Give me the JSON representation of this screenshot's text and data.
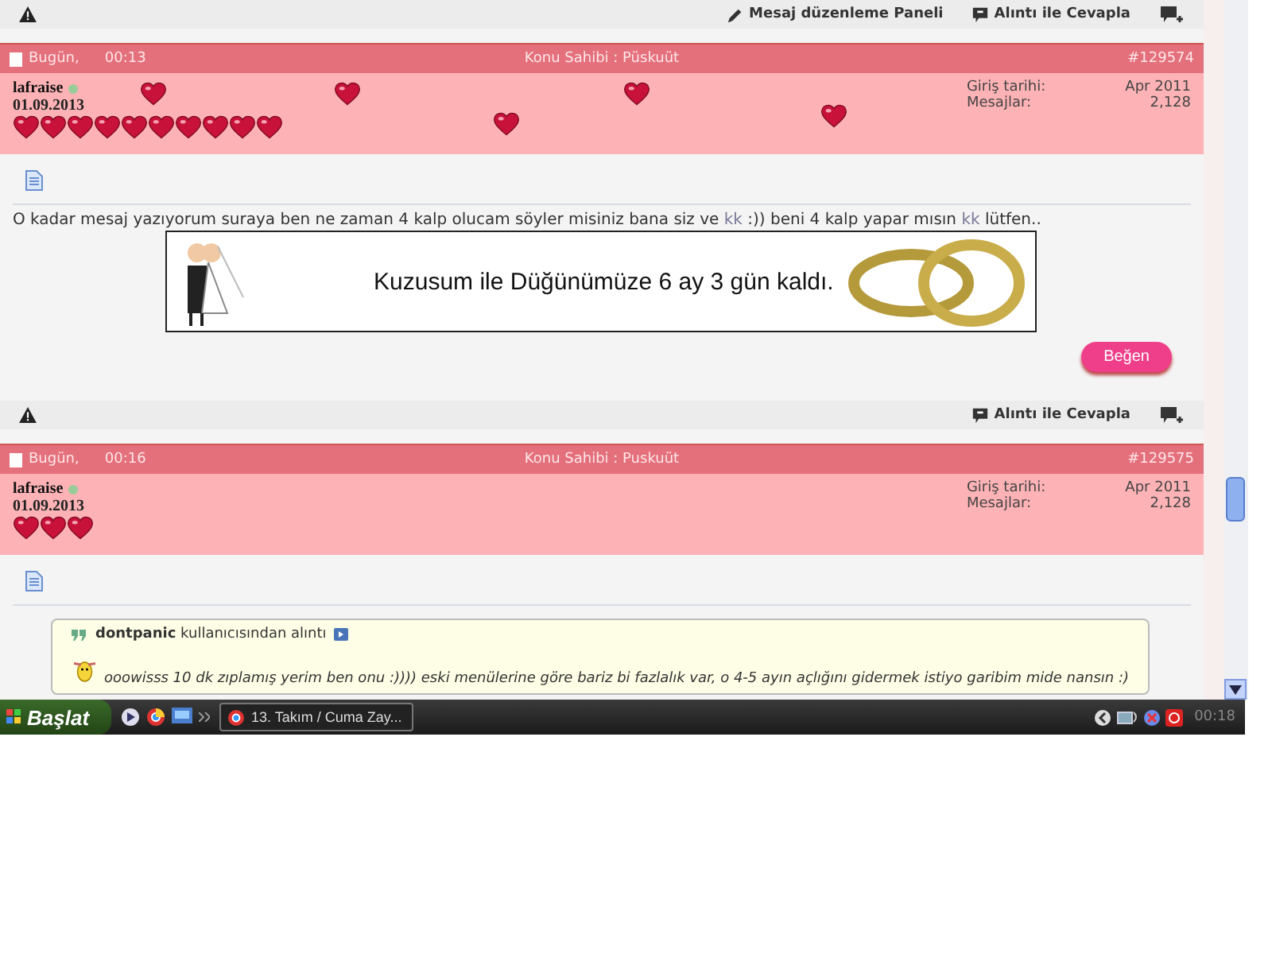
{
  "posts": [
    {
      "toolbar": {
        "actions": [
          {
            "kind": "edit",
            "label": "Mesaj düzenleme Paneli"
          },
          {
            "kind": "quote",
            "label": "Alıntı ile Cevapla"
          },
          {
            "kind": "multiquote"
          }
        ]
      },
      "header": {
        "day": "Bugün,",
        "time": "00:13",
        "owner": "Konu Sahibi : Püskuüt",
        "number": "#129574"
      },
      "user": {
        "name": "lafraise",
        "online": true,
        "date": "01.09.2013",
        "stars": 10,
        "join_label": "Giriş tarihi:",
        "join_value": "Apr 2011",
        "posts_label": "Mesajlar:",
        "posts_value": "2,128"
      },
      "message": [
        {
          "kind": "text",
          "text": "O kadar mesaj yazıyorum suraya ben ne zaman 4 kalp olucam söyler misiniz bana siz ve "
        },
        {
          "kind": "link",
          "text": "kk"
        },
        {
          "kind": "text",
          "text": " :)) beni 4 kalp yapar mısın "
        },
        {
          "kind": "link",
          "text": "kk"
        },
        {
          "kind": "text",
          "text": " lütfen.."
        }
      ],
      "banner": {
        "text": "Kuzusum ile Düğünümüze 6 ay 3 gün kaldı."
      },
      "like_button": "Beğen"
    },
    {
      "toolbar": {
        "actions": [
          {
            "kind": "quote",
            "label": "Alıntı ile Cevapla"
          },
          {
            "kind": "multiquote"
          }
        ]
      },
      "header": {
        "day": "Bugün,",
        "time": "00:16",
        "owner": "Konu Sahibi : Puskuüt",
        "number": "#129575"
      },
      "user": {
        "name": "lafraise",
        "online": true,
        "date": "01.09.2013",
        "stars": 3,
        "join_label": "Giriş tarihi:",
        "join_value": "Apr 2011",
        "posts_label": "Mesajlar:",
        "posts_value": "2,128"
      },
      "quote": {
        "author": "**dontpanic** kullanıcısından alıntı",
        "text": "ooowisss 10 dk zıplamış yerim ben onu :)))) eski menülerine göre bariz bi fazlalık var, o 4-5 ayın açlığını gidermek istiyo garibim mide nansın :)"
      }
    }
  ],
  "taskbar": {
    "start": "Başlat",
    "tasks": [
      {
        "label": "13. Takım / Cuma Zay...",
        "selected": true
      }
    ],
    "clock": "00:18"
  }
}
